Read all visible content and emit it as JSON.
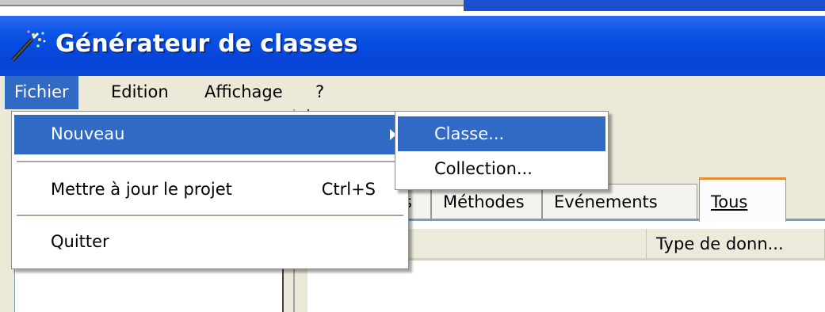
{
  "window": {
    "title": "Générateur de classes"
  },
  "menubar": {
    "items": [
      {
        "label": "Fichier"
      },
      {
        "label": "Edition"
      },
      {
        "label": "Affichage"
      },
      {
        "label": "?"
      }
    ]
  },
  "file_menu": {
    "items": [
      {
        "label": "Nouveau",
        "has_submenu": true
      },
      {
        "label": "Mettre à jour le projet",
        "shortcut": "Ctrl+S"
      },
      {
        "label": "Quitter"
      }
    ]
  },
  "new_submenu": {
    "items": [
      {
        "label": "Classe..."
      },
      {
        "label": "Collection..."
      }
    ]
  },
  "tabs": {
    "items": [
      {
        "label": "s"
      },
      {
        "label": "Méthodes"
      },
      {
        "label": "Evénements"
      },
      {
        "label": "Tous",
        "selected": true
      }
    ]
  },
  "list": {
    "columns": [
      {
        "label": ""
      },
      {
        "label": "Type de donn..."
      }
    ]
  },
  "colors": {
    "titlebar": "#0a53e6",
    "highlight": "#316ac5",
    "face": "#ece9d8"
  }
}
